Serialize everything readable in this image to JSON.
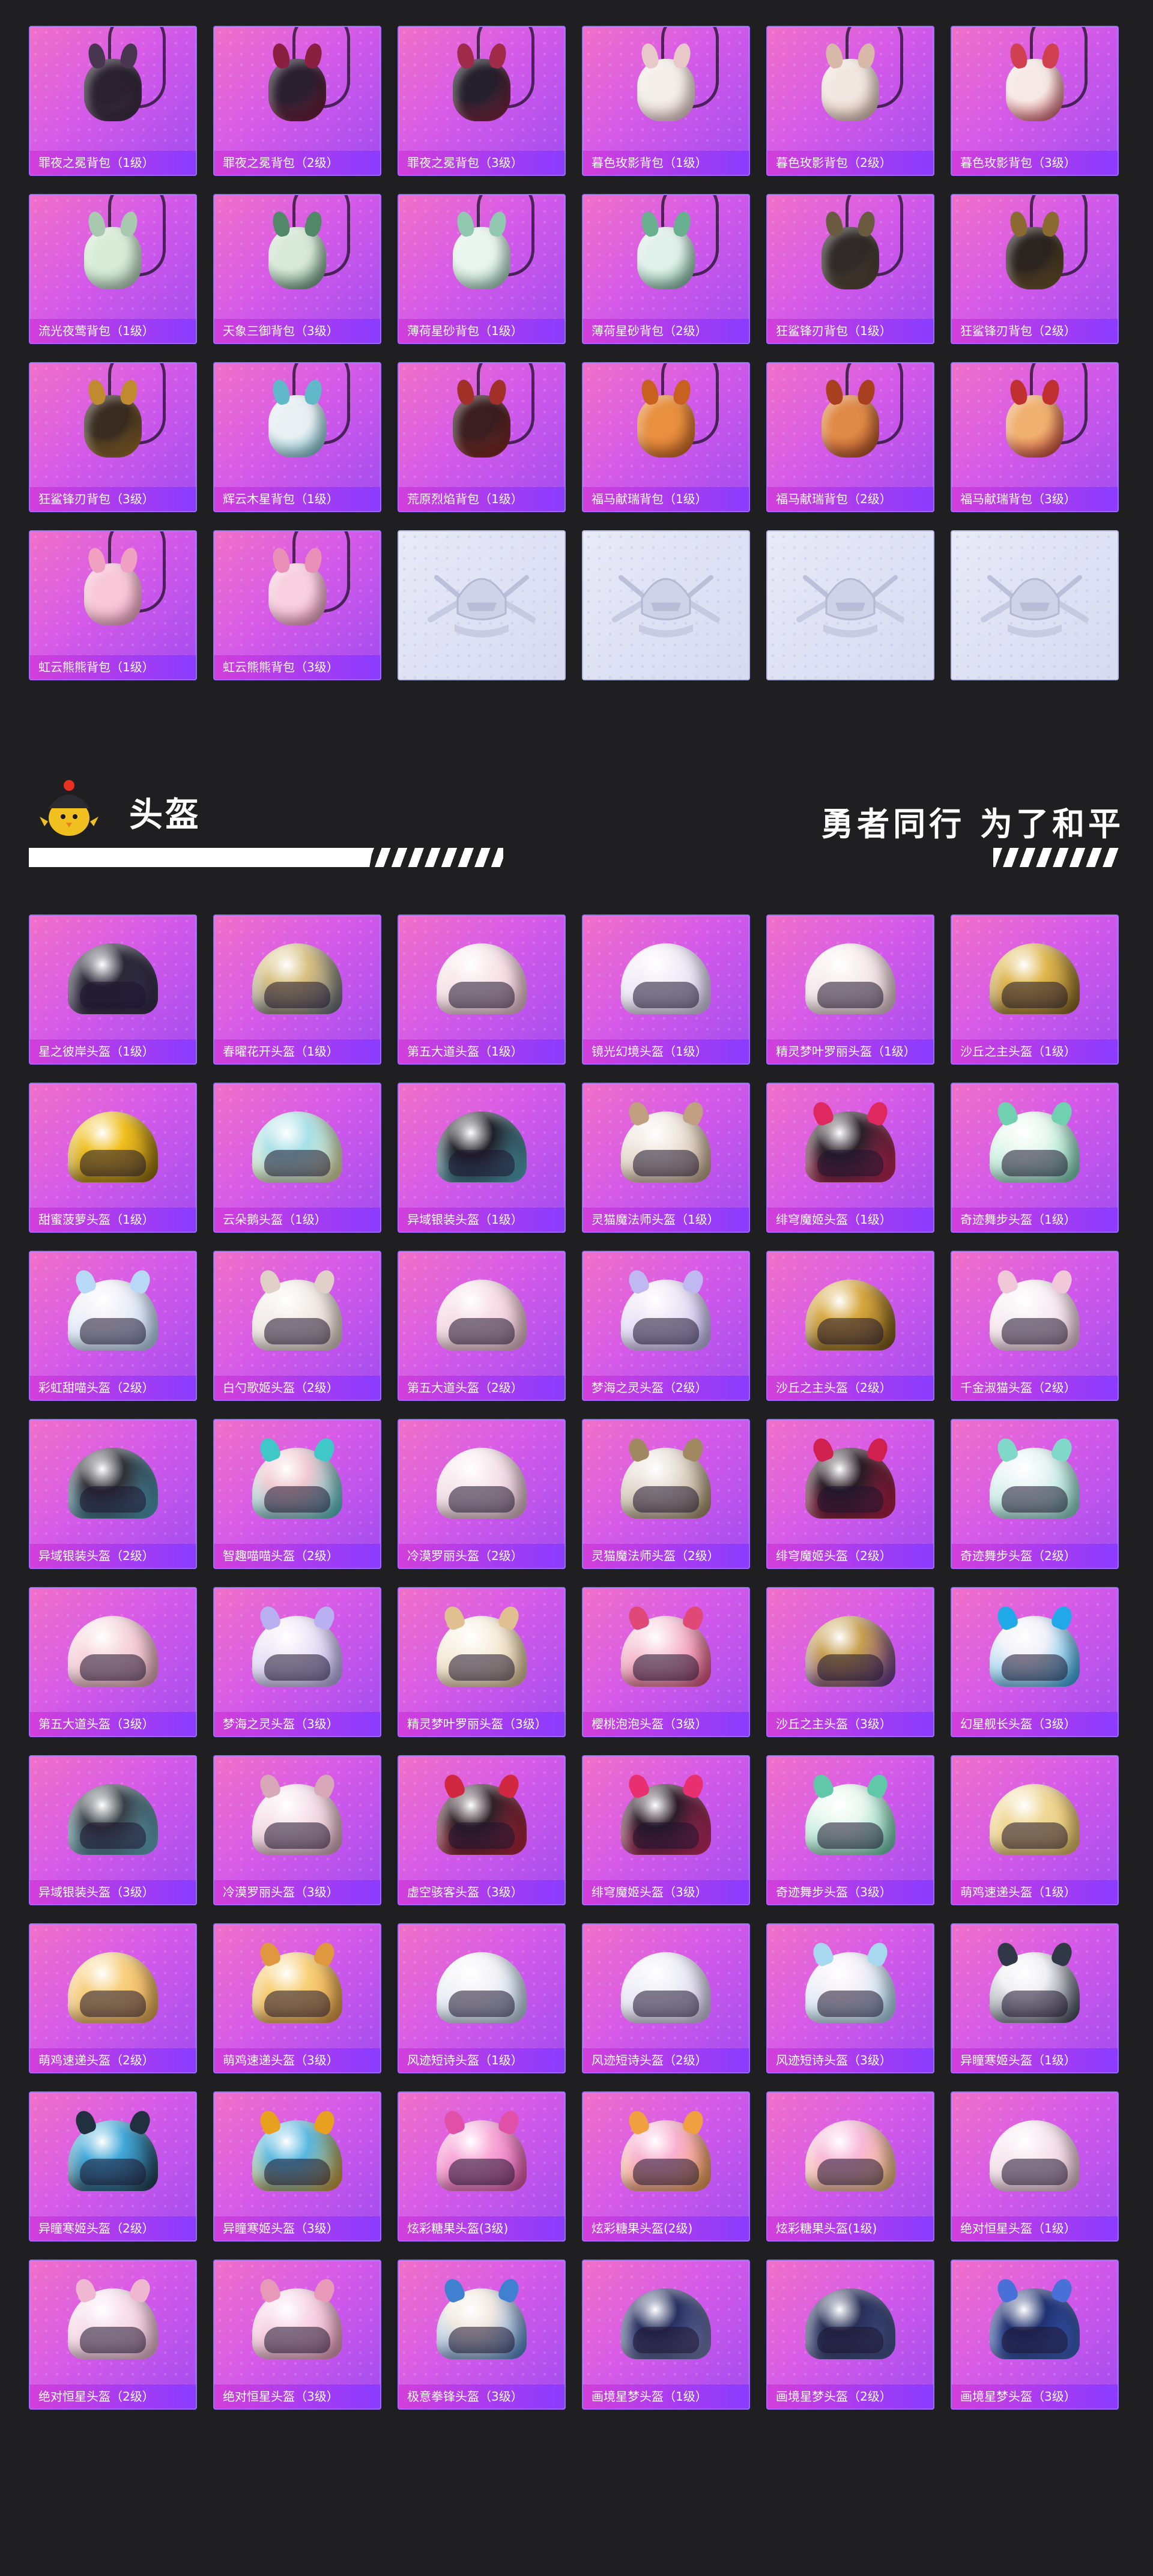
{
  "colors": {
    "page_bg": "#1f1f21",
    "card_gradient_start": "#f070c8",
    "card_gradient_end": "#a04cf0",
    "label_bar": "#a83cf0",
    "empty_card": "#e0e3f5"
  },
  "backpacks": {
    "items": [
      {
        "label": "罪夜之冕背包（1级）",
        "icon": "dark-bunny-backpack-icon",
        "c1": "#2a2230",
        "c2": "#4a3550"
      },
      {
        "label": "罪夜之冕背包（2级）",
        "icon": "dark-bunny-backpack-icon",
        "c1": "#2b2030",
        "c2": "#8a2040"
      },
      {
        "label": "罪夜之冕背包（3级）",
        "icon": "dark-bunny-backpack-icon",
        "c1": "#26202c",
        "c2": "#a02a4a"
      },
      {
        "label": "暮色玫影背包（1级）",
        "icon": "bat-bunny-backpack-icon",
        "c1": "#f4eee8",
        "c2": "#e8c8c8"
      },
      {
        "label": "暮色玫影背包（2级）",
        "icon": "doll-backpack-icon",
        "c1": "#f2e6e0",
        "c2": "#d8b8a8"
      },
      {
        "label": "暮色玫影背包（3级）",
        "icon": "doll-backpack-icon",
        "c1": "#f6e8e4",
        "c2": "#d04050"
      },
      {
        "label": "流光夜莺背包（1级）",
        "icon": "pouch-backpack-icon",
        "c1": "#d8ecd8",
        "c2": "#a8c8b0"
      },
      {
        "label": "天象三御背包（3级）",
        "icon": "scroll-backpack-icon",
        "c1": "#d8e8d8",
        "c2": "#508868"
      },
      {
        "label": "薄荷星砂背包（1级）",
        "icon": "mint-bag-backpack-icon",
        "c1": "#e8f4ee",
        "c2": "#90c8b0"
      },
      {
        "label": "薄荷星砂背包（2级）",
        "icon": "mint-bag-backpack-icon",
        "c1": "#e0f0ea",
        "c2": "#68b090"
      },
      {
        "label": "狂鲨锋刃背包（1级）",
        "icon": "shark-backpack-icon",
        "c1": "#302a28",
        "c2": "#6a5a40"
      },
      {
        "label": "狂鲨锋刃背包（2级）",
        "icon": "shark-backpack-icon",
        "c1": "#2c2420",
        "c2": "#8a6a30"
      },
      {
        "label": "狂鲨锋刃背包（3级）",
        "icon": "shark-backpack-icon",
        "c1": "#3a2c20",
        "c2": "#c08a30"
      },
      {
        "label": "辉云木星背包（1级）",
        "icon": "orb-backpack-icon",
        "c1": "#e8f0f4",
        "c2": "#60b8c8"
      },
      {
        "label": "荒原烈焰背包（1级）",
        "icon": "flame-backpack-icon",
        "c1": "#3a1e20",
        "c2": "#a03028"
      },
      {
        "label": "福马献瑞背包（1级）",
        "icon": "bunny-backpack-icon",
        "c1": "#e89040",
        "c2": "#c86020"
      },
      {
        "label": "福马献瑞背包（2级）",
        "icon": "bunny-backpack-icon",
        "c1": "#e08a48",
        "c2": "#a84020"
      },
      {
        "label": "福马献瑞背包（3级）",
        "icon": "bunny-backpack-icon",
        "c1": "#f0b070",
        "c2": "#c03030"
      },
      {
        "label": "虹云熊熊背包（1级）",
        "icon": "cloud-bear-backpack-icon",
        "c1": "#f8c8d8",
        "c2": "#f0a0c0"
      },
      {
        "label": "虹云熊熊背包（3级）",
        "icon": "cloud-bear-backpack-icon",
        "c1": "#f8d0e0",
        "c2": "#e890b8"
      }
    ],
    "empty_slots": [
      {
        "icon": "pubg-emblem-icon"
      },
      {
        "icon": "pubg-emblem-icon"
      },
      {
        "icon": "pubg-emblem-icon"
      },
      {
        "icon": "pubg-emblem-icon"
      }
    ]
  },
  "helmet_section": {
    "title": "头盔",
    "slogan": "勇者同行 为了和平",
    "mascot_icon": "chick-helmet-mascot-icon"
  },
  "helmets": {
    "items": [
      {
        "label": "星之彼岸头盔（1级）",
        "icon": "helmet-icon",
        "c1": "#2a2838",
        "c2": "#3a3050",
        "ears": false
      },
      {
        "label": "春曜花开头盔（1级）",
        "icon": "helmet-icon",
        "c1": "#d8c080",
        "c2": "#5a6880",
        "ears": false
      },
      {
        "label": "第五大道头盔（1级）",
        "icon": "helmet-icon",
        "c1": "#f8e8ec",
        "c2": "#f0c0d0",
        "ears": false
      },
      {
        "label": "镜光幻境头盔（1级）",
        "icon": "helmet-icon",
        "c1": "#f4eef8",
        "c2": "#d8d0f0",
        "ears": false
      },
      {
        "label": "精灵梦叶罗丽头盔（1级）",
        "icon": "helmet-icon",
        "c1": "#f8eeee",
        "c2": "#e8c8d0",
        "ears": false
      },
      {
        "label": "沙丘之主头盔（1级）",
        "icon": "helmet-icon",
        "c1": "#e0b850",
        "c2": "#806020",
        "ears": false
      },
      {
        "label": "甜蜜菠萝头盔（1级）",
        "icon": "helmet-icon",
        "c1": "#f0c020",
        "c2": "#8a6810",
        "ears": false
      },
      {
        "label": "云朵鹅头盔（1级）",
        "icon": "helmet-icon",
        "c1": "#a8e0e8",
        "c2": "#f0e0a0",
        "ears": false
      },
      {
        "label": "异域银装头盔（1级）",
        "icon": "helmet-icon",
        "c1": "#202028",
        "c2": "#60c8e0",
        "ears": false
      },
      {
        "label": "灵猫魔法师头盔（1级）",
        "icon": "helmet-icon",
        "c1": "#f0e8e0",
        "c2": "#c0a080",
        "ears": true
      },
      {
        "label": "绯穹魔姬头盔（1级）",
        "icon": "helmet-icon",
        "c1": "#2a2028",
        "c2": "#e02860",
        "ears": true
      },
      {
        "label": "奇迹舞步头盔（1级）",
        "icon": "helmet-icon",
        "c1": "#e8f8f0",
        "c2": "#70d0b0",
        "ears": true
      },
      {
        "label": "彩虹甜喵头盔（2级）",
        "icon": "helmet-icon",
        "c1": "#f0f0f8",
        "c2": "#b8d8f8",
        "ears": true
      },
      {
        "label": "白勺歌姬头盔（2级）",
        "icon": "helmet-icon",
        "c1": "#f4eeea",
        "c2": "#e0d0c8",
        "ears": true
      },
      {
        "label": "第五大道头盔（2级）",
        "icon": "helmet-icon",
        "c1": "#f8e0e8",
        "c2": "#e8b8c8",
        "ears": false
      },
      {
        "label": "梦海之灵头盔（2级）",
        "icon": "helmet-icon",
        "c1": "#f0e8f8",
        "c2": "#c0b8f0",
        "ears": true
      },
      {
        "label": "沙丘之主头盔（2级）",
        "icon": "helmet-icon",
        "c1": "#d8a840",
        "c2": "#705018",
        "ears": false
      },
      {
        "label": "千金淑猫头盔（2级）",
        "icon": "helmet-icon",
        "c1": "#f8f0f4",
        "c2": "#f0c8d8",
        "ears": true
      },
      {
        "label": "异域银装头盔（2级）",
        "icon": "helmet-icon",
        "c1": "#303038",
        "c2": "#58b8d8",
        "ears": false
      },
      {
        "label": "智趣喵喵头盔（2级）",
        "icon": "helmet-icon",
        "c1": "#f0c8d0",
        "c2": "#40c8c8",
        "ears": true
      },
      {
        "label": "冷漠罗丽头盔（2级）",
        "icon": "helmet-icon",
        "c1": "#f8e8ee",
        "c2": "#e0b8c8",
        "ears": false
      },
      {
        "label": "灵猫魔法师头盔（2级）",
        "icon": "helmet-icon",
        "c1": "#e8e0d8",
        "c2": "#a08860",
        "ears": true
      },
      {
        "label": "绯穹魔姬头盔（2级）",
        "icon": "helmet-icon",
        "c1": "#281c24",
        "c2": "#d02050",
        "ears": true
      },
      {
        "label": "奇迹舞步头盔（2级）",
        "icon": "helmet-icon",
        "c1": "#e8f4f4",
        "c2": "#80d8c8",
        "ears": true
      },
      {
        "label": "第五大道头盔（3级）",
        "icon": "helmet-icon",
        "c1": "#f8d8e0",
        "c2": "#e8a8b8",
        "ears": false
      },
      {
        "label": "梦海之灵头盔（3级）",
        "icon": "helmet-icon",
        "c1": "#f0e8f8",
        "c2": "#b8b0f0",
        "ears": true
      },
      {
        "label": "精灵梦叶罗丽头盔（3级）",
        "icon": "helmet-icon",
        "c1": "#f8f0e0",
        "c2": "#e0c090",
        "ears": true
      },
      {
        "label": "樱桃泡泡头盔（3级）",
        "icon": "helmet-icon",
        "c1": "#f8c8d8",
        "c2": "#e04878",
        "ears": true
      },
      {
        "label": "沙丘之主头盔（3级）",
        "icon": "helmet-icon",
        "c1": "#c8a050",
        "c2": "#6030a0",
        "ears": false
      },
      {
        "label": "幻星舰长头盔（3级）",
        "icon": "helmet-icon",
        "c1": "#f0f0f8",
        "c2": "#20a8e8",
        "ears": true
      },
      {
        "label": "异域银装头盔（3级）",
        "icon": "helmet-icon",
        "c1": "#384048",
        "c2": "#70c8e0",
        "ears": false
      },
      {
        "label": "冷漠罗丽头盔（3级）",
        "icon": "helmet-icon",
        "c1": "#f8e4ec",
        "c2": "#d8a8b8",
        "ears": true
      },
      {
        "label": "虚空骇客头盔（3级）",
        "icon": "helmet-icon",
        "c1": "#302028",
        "c2": "#d02840",
        "ears": true
      },
      {
        "label": "绯穹魔姬头盔（3级）",
        "icon": "helmet-icon",
        "c1": "#2c1c28",
        "c2": "#e83070",
        "ears": true
      },
      {
        "label": "奇迹舞步头盔（3级）",
        "icon": "helmet-icon",
        "c1": "#e8f8f0",
        "c2": "#60c8a8",
        "ears": true
      },
      {
        "label": "萌鸡速递头盔（1级）",
        "icon": "helmet-icon",
        "c1": "#f0d898",
        "c2": "#e8c060",
        "ears": false
      },
      {
        "label": "萌鸡速递头盔（2级）",
        "icon": "helmet-icon",
        "c1": "#f8d080",
        "c2": "#e8a850",
        "ears": false
      },
      {
        "label": "萌鸡速递头盔（3级）",
        "icon": "helmet-icon",
        "c1": "#f8d078",
        "c2": "#e09840",
        "ears": true
      },
      {
        "label": "风迹短诗头盔（1级）",
        "icon": "helmet-icon",
        "c1": "#f4f4f8",
        "c2": "#b8d0e8",
        "ears": false
      },
      {
        "label": "风迹短诗头盔（2级）",
        "icon": "helmet-icon",
        "c1": "#f0f0f8",
        "c2": "#d0c8e8",
        "ears": false
      },
      {
        "label": "风迹短诗头盔（3级）",
        "icon": "helmet-icon",
        "c1": "#f4f0f8",
        "c2": "#a8d8f0",
        "ears": true
      },
      {
        "label": "异瞳寒姬头盔（1级）",
        "icon": "helmet-icon",
        "c1": "#f0f0f4",
        "c2": "#303848",
        "ears": true
      },
      {
        "label": "异瞳寒姬头盔（2级）",
        "icon": "helmet-icon",
        "c1": "#40a8d8",
        "c2": "#203040",
        "ears": true
      },
      {
        "label": "异瞳寒姬头盔（3级）",
        "icon": "helmet-icon",
        "c1": "#58b8e0",
        "c2": "#e8a020",
        "ears": true
      },
      {
        "label": "炫彩糖果头盔(3级)",
        "icon": "helmet-icon",
        "c1": "#f8a8d8",
        "c2": "#e050a8",
        "ears": true
      },
      {
        "label": "炫彩糖果头盔(2级)",
        "icon": "helmet-icon",
        "c1": "#f8b0d0",
        "c2": "#f0a040",
        "ears": true
      },
      {
        "label": "炫彩糖果头盔(1级)",
        "icon": "helmet-icon",
        "c1": "#f8b8d8",
        "c2": "#f0c070",
        "ears": false
      },
      {
        "label": "绝对恒星头盔（1级）",
        "icon": "helmet-icon",
        "c1": "#f8e8f0",
        "c2": "#e8c0d0",
        "ears": false
      },
      {
        "label": "绝对恒星头盔（2级）",
        "icon": "helmet-icon",
        "c1": "#f8e0ec",
        "c2": "#f0b8d0",
        "ears": true
      },
      {
        "label": "绝对恒星头盔（3级）",
        "icon": "helmet-icon",
        "c1": "#f8d8e8",
        "c2": "#e898b8",
        "ears": true
      },
      {
        "label": "极意拳锋头盔（3级）",
        "icon": "helmet-icon",
        "c1": "#f0e8e0",
        "c2": "#4080d0",
        "ears": true
      },
      {
        "label": "画境星梦头盔（1级）",
        "icon": "helmet-icon",
        "c1": "#283060",
        "c2": "#8890c8",
        "ears": false
      },
      {
        "label": "画境星梦头盔（2级）",
        "icon": "helmet-icon",
        "c1": "#283058",
        "c2": "#5060a0",
        "ears": false
      },
      {
        "label": "画境星梦头盔（3级）",
        "icon": "helmet-icon",
        "c1": "#203070",
        "c2": "#4870d8",
        "ears": true
      }
    ]
  }
}
